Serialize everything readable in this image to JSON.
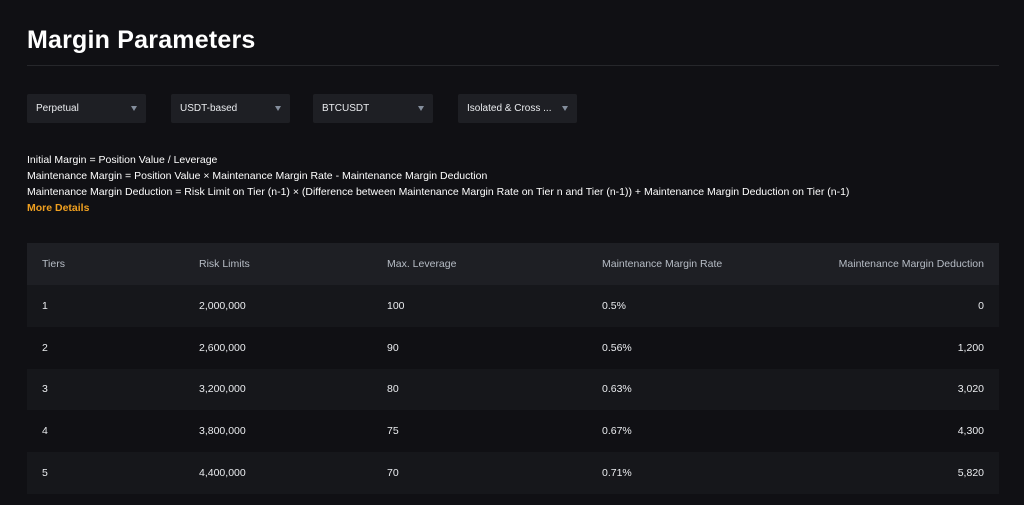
{
  "page": {
    "title": "Margin Parameters"
  },
  "filters": [
    {
      "label": "Perpetual"
    },
    {
      "label": "USDT-based"
    },
    {
      "label": "BTCUSDT"
    },
    {
      "label": "Isolated & Cross ..."
    }
  ],
  "formulas": {
    "initial": "Initial Margin = Position Value / Leverage",
    "maintenance": "Maintenance Margin = Position Value × Maintenance Margin Rate - Maintenance Margin Deduction",
    "deduction": "Maintenance Margin Deduction = Risk Limit on Tier (n-1) × (Difference between Maintenance Margin Rate on Tier n and Tier (n-1)) + Maintenance Margin Deduction on Tier (n-1)",
    "more_details": "More Details"
  },
  "colors": {
    "accent": "#f0a020",
    "background": "#101014",
    "header_bg": "#1e1f24"
  },
  "table": {
    "headers": [
      "Tiers",
      "Risk Limits",
      "Max. Leverage",
      "Maintenance Margin Rate",
      "Maintenance Margin Deduction"
    ],
    "rows": [
      [
        "1",
        "2,000,000",
        "100",
        "0.5%",
        "0"
      ],
      [
        "2",
        "2,600,000",
        "90",
        "0.56%",
        "1,200"
      ],
      [
        "3",
        "3,200,000",
        "80",
        "0.63%",
        "3,020"
      ],
      [
        "4",
        "3,800,000",
        "75",
        "0.67%",
        "4,300"
      ],
      [
        "5",
        "4,400,000",
        "70",
        "0.71%",
        "5,820"
      ]
    ]
  }
}
